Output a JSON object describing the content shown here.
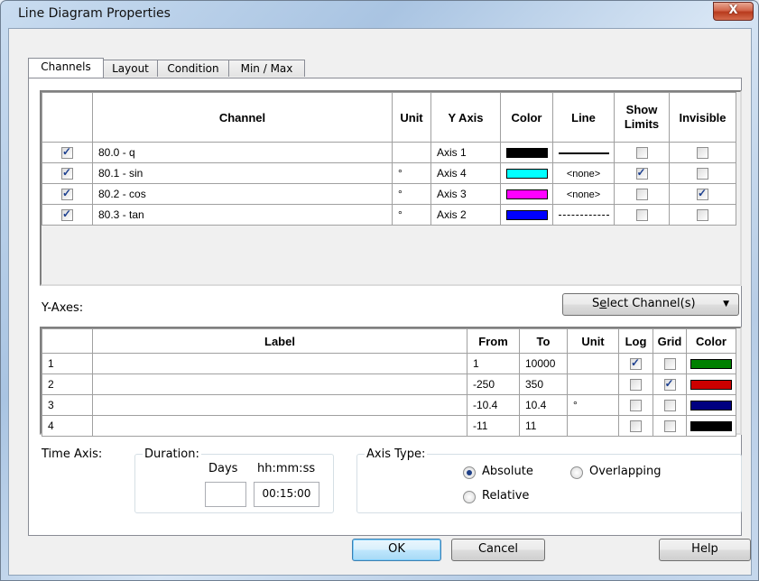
{
  "window": {
    "title": "Line Diagram Properties",
    "close_glyph": "X"
  },
  "tabs": [
    {
      "label": "Channels",
      "active": true
    },
    {
      "label": "Layout",
      "active": false
    },
    {
      "label": "Condition",
      "active": false
    },
    {
      "label": "Min / Max",
      "active": false
    }
  ],
  "channels_table": {
    "headers": {
      "channel": "Channel",
      "unit": "Unit",
      "yaxis": "Y Axis",
      "color": "Color",
      "line": "Line",
      "show_limits_1": "Show",
      "show_limits_2": "Limits",
      "invisible": "Invisible"
    },
    "rows": [
      {
        "checked": true,
        "channel": "80.0 - q",
        "unit": "",
        "yaxis": "Axis 1",
        "color": "#000000",
        "line": "solid",
        "line_text": "",
        "show_limits": false,
        "invisible": false
      },
      {
        "checked": true,
        "channel": "80.1 - sin",
        "unit": "°",
        "yaxis": "Axis 4",
        "color": "#00ffff",
        "line": "none",
        "line_text": "<none>",
        "show_limits": true,
        "invisible": false
      },
      {
        "checked": true,
        "channel": "80.2 - cos",
        "unit": "°",
        "yaxis": "Axis 3",
        "color": "#ff00ff",
        "line": "none",
        "line_text": "<none>",
        "show_limits": false,
        "invisible": true
      },
      {
        "checked": true,
        "channel": "80.3 - tan",
        "unit": "°",
        "yaxis": "Axis 2",
        "color": "#0000ff",
        "line": "dashed",
        "line_text": "",
        "show_limits": false,
        "invisible": false
      }
    ]
  },
  "yaxes_label": "Y-Axes:",
  "select_channels": {
    "label_prefix": "S",
    "label_underlined": "e",
    "label_suffix": "lect Channel(s)",
    "arrow": "▼"
  },
  "yaxes_table": {
    "headers": {
      "label": "Label",
      "from": "From",
      "to": "To",
      "unit": "Unit",
      "log": "Log",
      "grid": "Grid",
      "color": "Color"
    },
    "rows": [
      {
        "num": "1",
        "label": "",
        "from": "1",
        "to": "10000",
        "unit": "",
        "log": true,
        "grid": false,
        "color": "#008000"
      },
      {
        "num": "2",
        "label": "",
        "from": "-250",
        "to": "350",
        "unit": "",
        "log": false,
        "grid": true,
        "color": "#cc0000"
      },
      {
        "num": "3",
        "label": "",
        "from": "-10.4",
        "to": "10.4",
        "unit": "°",
        "log": false,
        "grid": false,
        "color": "#000080"
      },
      {
        "num": "4",
        "label": "",
        "from": "-11",
        "to": "11",
        "unit": "",
        "log": false,
        "grid": false,
        "color": "#000000"
      }
    ]
  },
  "time_axis": {
    "label": "Time Axis:",
    "duration_legend": "Duration:",
    "days_label": "Days",
    "days_value": "",
    "hms_label": "hh:mm:ss",
    "hms_value": "00:15:00"
  },
  "axis_type": {
    "legend": "Axis Type:",
    "options": [
      {
        "label": "Absolute",
        "selected": true
      },
      {
        "label": "Overlapping",
        "selected": false
      },
      {
        "label": "Relative",
        "selected": false
      }
    ]
  },
  "buttons": {
    "ok": "OK",
    "cancel": "Cancel",
    "help": "Help"
  }
}
